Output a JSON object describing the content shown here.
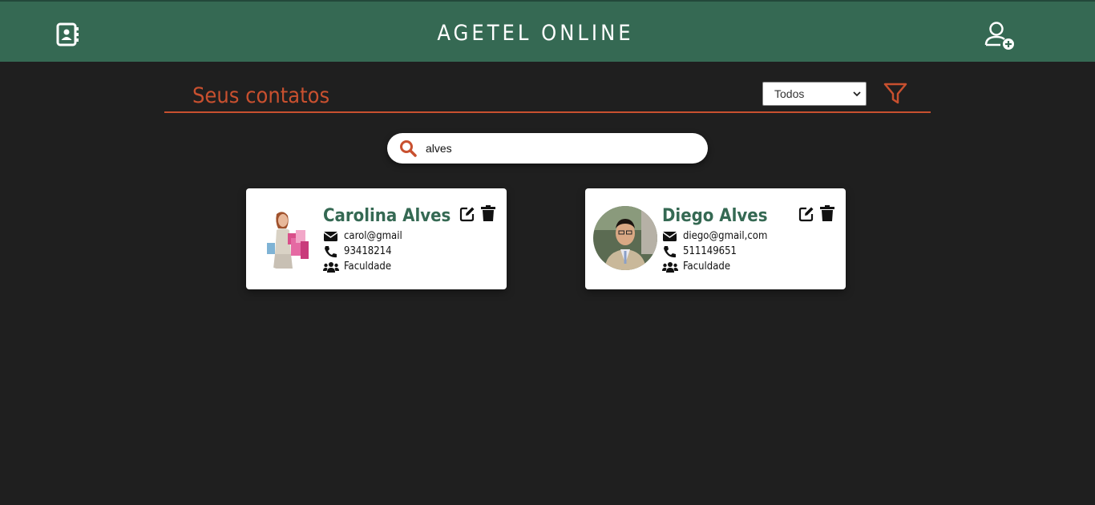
{
  "header": {
    "title": "AGETEL ONLINE",
    "logo_icon": "contact-book-icon",
    "add_user_icon": "user-plus-icon"
  },
  "section": {
    "title": "Seus contatos",
    "filter_selected": "Todos",
    "filter_icon": "filter-icon"
  },
  "search": {
    "value": "alves",
    "icon": "search-icon"
  },
  "contacts": [
    {
      "name": "Carolina Alves",
      "email": "carol@gmail",
      "phone": "93418214",
      "group": "Faculdade"
    },
    {
      "name": "Diego Alves",
      "email": "diego@gmail,com",
      "phone": "511149651",
      "group": "Faculdade"
    }
  ],
  "colors": {
    "header_bg": "#356953",
    "page_bg": "#1f1f1f",
    "accent": "#c8502f",
    "name_color": "#356953"
  }
}
